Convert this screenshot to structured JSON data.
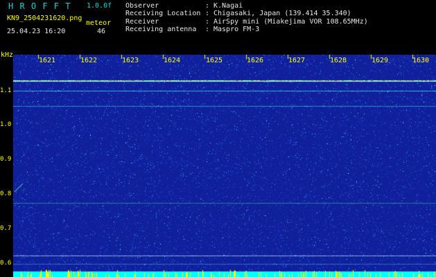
{
  "header": {
    "brand": "H R O F F T",
    "version": "1.0.0f",
    "filename": "KN9_2504231620.png",
    "meteor_label": "meteor",
    "meteor_count": "46",
    "datetime": "25.04.23 16:20",
    "info": [
      {
        "key": "Observer",
        "sep": ":",
        "value": "K.Nagai"
      },
      {
        "key": "Receiving Location",
        "sep": ":",
        "value": "Chigasaki, Japan (139.414 35.340)"
      },
      {
        "key": "Receiver",
        "sep": ":",
        "value": "AirSpy mini (Miakejima VOR 108.65MHz)"
      },
      {
        "key": "Receiving antenna",
        "sep": ":",
        "value": "Maspro FM-3"
      }
    ]
  },
  "axis": {
    "y_unit": "kHz",
    "y_ticks": [
      "1.1",
      "1.0",
      "0.9",
      "0.8",
      "0.7",
      "0.6"
    ],
    "x_ticks": [
      "1621",
      "1622",
      "1623",
      "1624",
      "1625",
      "1626",
      "1627",
      "1628",
      "1629",
      "1630"
    ]
  },
  "colors": {
    "background": "#10209a",
    "noise_low": "#2040e0",
    "noise_high": "#40e0ff",
    "label_cyan": "#00d8d8",
    "label_yellow": "#ffff00",
    "bottom_band": "#00ffff"
  }
}
